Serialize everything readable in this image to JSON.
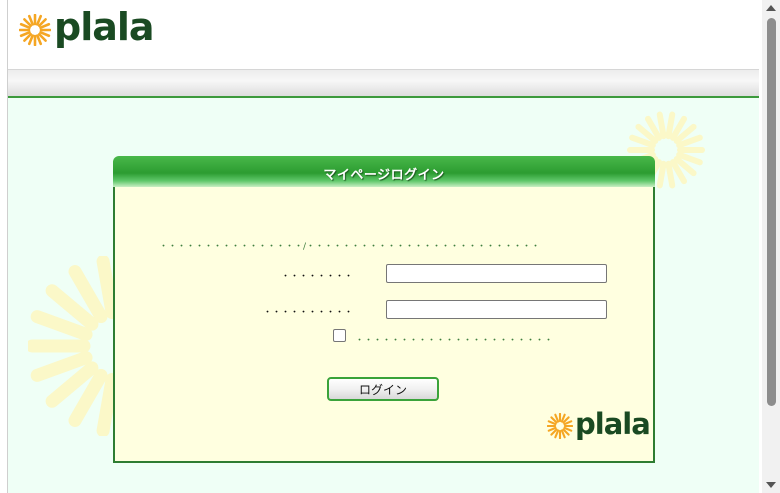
{
  "header": {
    "logo_text": "plala",
    "logo_icon": "sunflower-icon"
  },
  "panel": {
    "title": "マイページログイン",
    "intro_text": "・・・・・・・・・・・・・・・・/・・・・・・・・・・・・・・・・・・・・・・・・・・",
    "userid_label": "・・・・・・・・",
    "password_label": "・・・・・・・・・・",
    "userid_value": "",
    "password_value": "",
    "remember_label": "・・・・・・・・・・・・・・・・・・・・・・",
    "remember_checked": false,
    "login_button": "ログイン",
    "footer_logo_text": "plala"
  },
  "colors": {
    "brand_green": "#1a4a22",
    "accent_green": "#2c9c31",
    "sun_yellow": "#f5a623",
    "panel_bg": "#ffffe0",
    "page_bg": "#effff6"
  }
}
